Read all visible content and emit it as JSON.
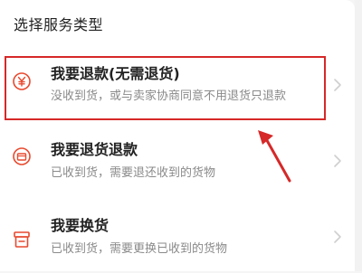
{
  "header": {
    "title": "选择服务类型"
  },
  "options": [
    {
      "title": "我要退款(无需退货)",
      "subtitle": "没收到货，或与卖家协商同意不用退货只退款",
      "icon": "refund-coin-icon"
    },
    {
      "title": "我要退货退款",
      "subtitle": "已收到货，需要退还收到的货物",
      "icon": "return-box-icon"
    },
    {
      "title": "我要换货",
      "subtitle": "已收到货，需要更换已收到的货物",
      "icon": "exchange-box-icon"
    }
  ],
  "colors": {
    "accent": "#e8492e",
    "highlight": "#d62828",
    "text": "#222222",
    "subtext": "#8a8a8a"
  }
}
